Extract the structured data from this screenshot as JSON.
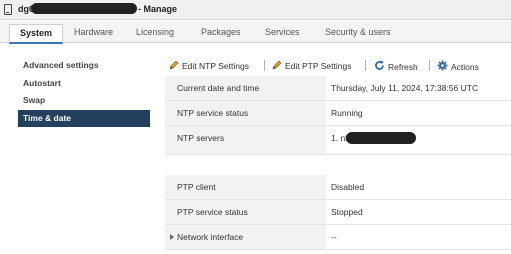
{
  "window": {
    "host_name": "dg01",
    "title_suffix": "- Manage"
  },
  "tabs": [
    {
      "label": "System",
      "active": true
    },
    {
      "label": "Hardware",
      "active": false
    },
    {
      "label": "Licensing",
      "active": false
    },
    {
      "label": "Packages",
      "active": false
    },
    {
      "label": "Services",
      "active": false
    },
    {
      "label": "Security & users",
      "active": false
    }
  ],
  "sidebar": {
    "items": [
      {
        "label": "Advanced settings",
        "active": false
      },
      {
        "label": "Autostart",
        "active": false
      },
      {
        "label": "Swap",
        "active": false
      },
      {
        "label": "Time & date",
        "active": true
      }
    ]
  },
  "toolbar": {
    "edit_ntp_label": "Edit NTP Settings",
    "edit_ptp_label": "Edit PTP Settings",
    "refresh_label": "Refresh",
    "actions_label": "Actions"
  },
  "ntp_table": {
    "rows": [
      {
        "label": "Current date and time",
        "value": "Thursday, July 11, 2024, 17:38:56 UTC"
      },
      {
        "label": "NTP service status",
        "value": "Running"
      },
      {
        "label": "NTP servers",
        "value": "1. ntp"
      }
    ]
  },
  "ptp_table": {
    "rows": [
      {
        "label": "PTP client",
        "value": "Disabled"
      },
      {
        "label": "PTP service status",
        "value": "Stopped"
      },
      {
        "label": "Network interface",
        "value": "--"
      }
    ]
  },
  "colors": {
    "accent": "#3b74b8",
    "sidebar_active": "#23415f",
    "label_bg": "#f2f2f2"
  }
}
